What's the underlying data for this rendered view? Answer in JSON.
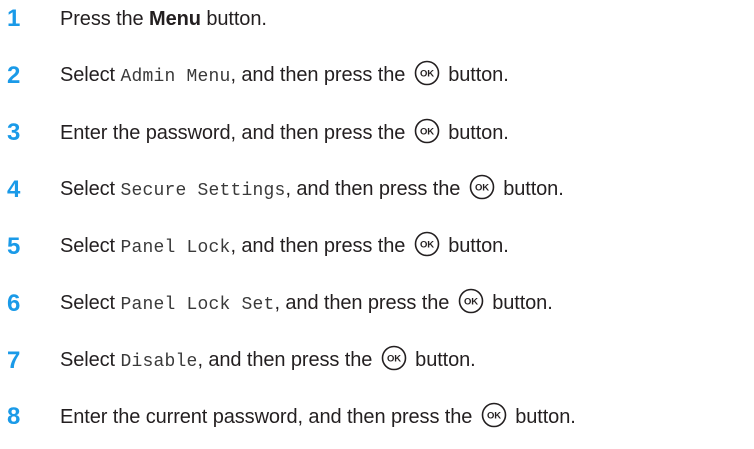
{
  "steps": [
    {
      "number": "1",
      "before": "Press the ",
      "bold": "Menu",
      "after": " button."
    },
    {
      "number": "2",
      "before": "Select ",
      "code": "Admin Menu",
      "mid": ", and then press the ",
      "icon": "ok-button-icon",
      "after": " button."
    },
    {
      "number": "3",
      "before": "Enter the password, and then press the ",
      "icon": "ok-button-icon",
      "after": " button."
    },
    {
      "number": "4",
      "before": "Select ",
      "code": "Secure Settings",
      "mid": ", and then press the ",
      "icon": "ok-button-icon",
      "after": " button."
    },
    {
      "number": "5",
      "before": "Select ",
      "code": "Panel Lock",
      "mid": ", and then press the ",
      "icon": "ok-button-icon",
      "after": " button."
    },
    {
      "number": "6",
      "before": "Select ",
      "code": "Panel Lock Set",
      "mid": ", and then press the ",
      "icon": "ok-button-icon",
      "after": " button."
    },
    {
      "number": "7",
      "before": "Select ",
      "code": "Disable",
      "mid": ", and then press the ",
      "icon": "ok-button-icon",
      "after": " button."
    },
    {
      "number": "8",
      "before": "Enter the current password, and then press the ",
      "icon": "ok-button-icon",
      "after": " button."
    }
  ],
  "ok_icon_label": "OK",
  "colors": {
    "step_number": "#1a9ae8",
    "text": "#231f20"
  }
}
